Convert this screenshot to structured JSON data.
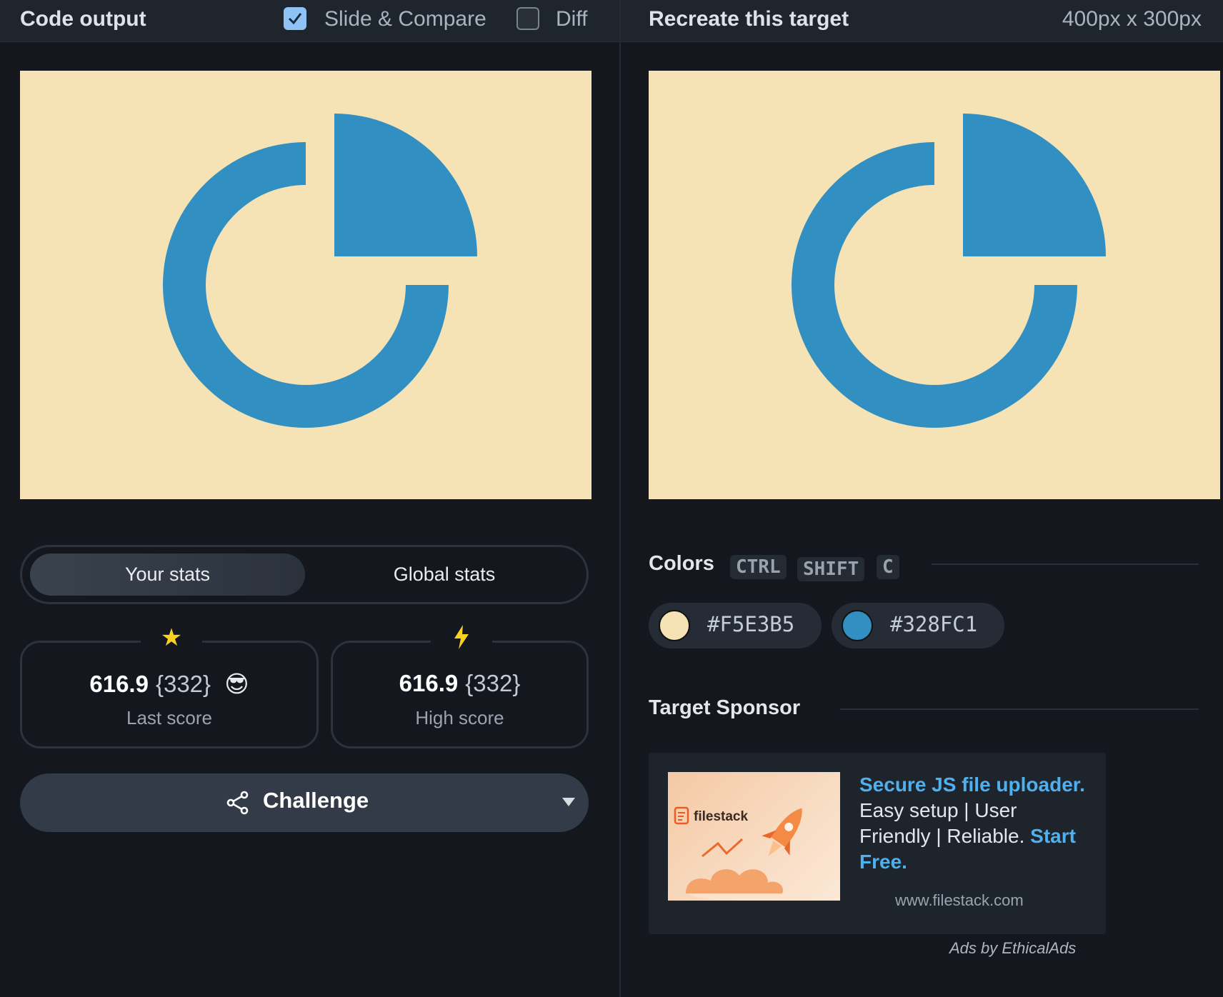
{
  "left_panel": {
    "title": "Code output",
    "slide_compare": {
      "label": "Slide & Compare",
      "checked": true
    },
    "diff": {
      "label": "Diff",
      "checked": false
    },
    "stats_tabs": {
      "your_stats": "Your stats",
      "global_stats": "Global stats",
      "active": "your_stats"
    },
    "last_score": {
      "value": "616.9",
      "count": "{332}",
      "emoji": "😎",
      "label": "Last score"
    },
    "high_score": {
      "value": "616.9",
      "count": "{332}",
      "label": "High score"
    },
    "challenge_button": {
      "label": "Challenge"
    }
  },
  "right_panel": {
    "title": "Recreate this target",
    "dimensions": "400px x 300px",
    "colors_section": {
      "title": "Colors",
      "shortcut": [
        "CTRL",
        "SHIFT",
        "C"
      ],
      "swatches": [
        {
          "hex": "#F5E3B5",
          "color": "#f5e3b5"
        },
        {
          "hex": "#328FC1",
          "color": "#328fc1"
        }
      ]
    },
    "sponsor": {
      "title": "Target Sponsor",
      "image_logo_text": "filestack",
      "headline": "Secure JS file uploader.",
      "body": "Easy setup | User Friendly | Reliable.",
      "cta": "Start Free.",
      "url": "www.filestack.com",
      "attribution": "Ads by EthicalAds"
    }
  },
  "target_colors": {
    "background": "#f5e3b5",
    "shape": "#328fc1"
  }
}
